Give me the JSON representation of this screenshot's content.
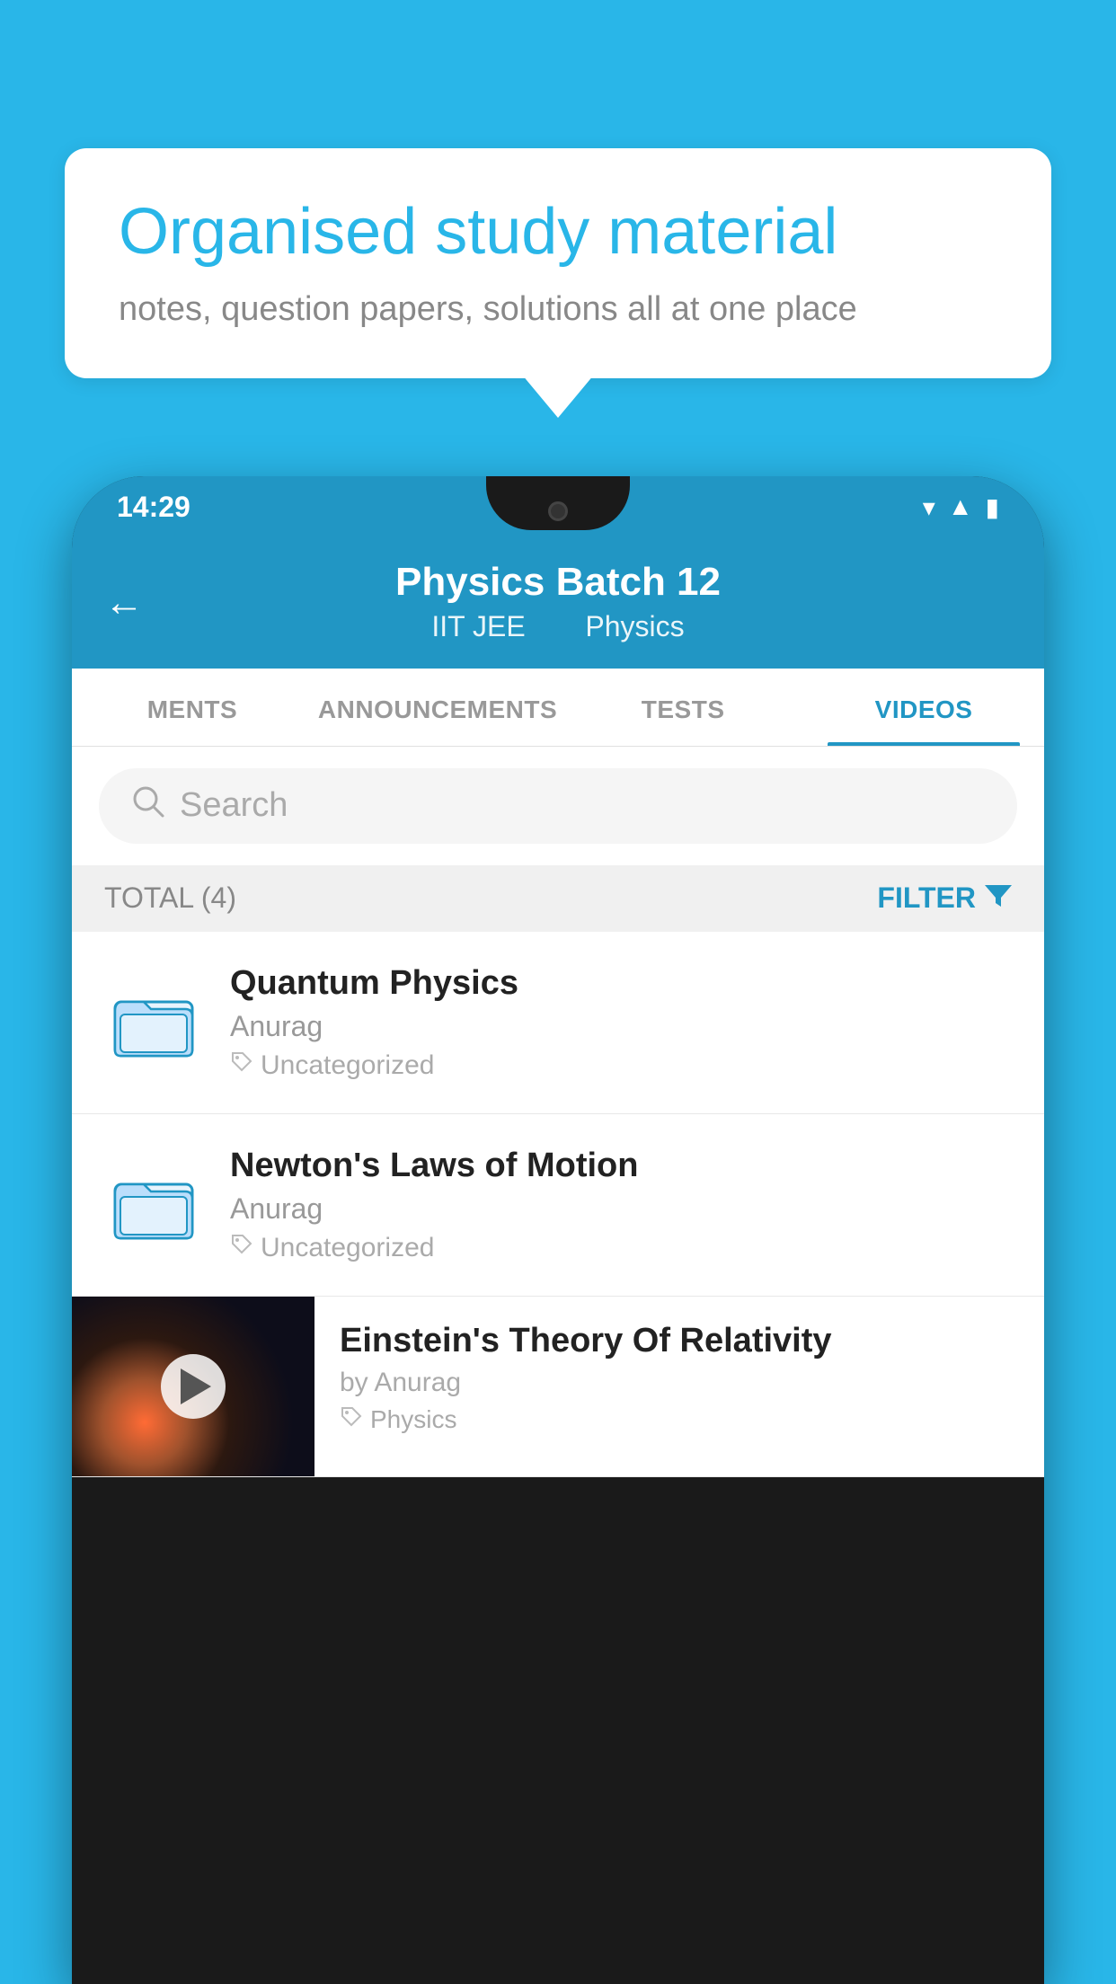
{
  "background": {
    "color": "#29b6e8"
  },
  "bubble": {
    "title": "Organised study material",
    "subtitle": "notes, question papers, solutions all at one place"
  },
  "phone": {
    "statusBar": {
      "time": "14:29"
    },
    "header": {
      "title": "Physics Batch 12",
      "subtitle1": "IIT JEE",
      "subtitle2": "Physics",
      "backLabel": "←"
    },
    "tabs": [
      {
        "label": "MENTS",
        "active": false
      },
      {
        "label": "ANNOUNCEMENTS",
        "active": false
      },
      {
        "label": "TESTS",
        "active": false
      },
      {
        "label": "VIDEOS",
        "active": true
      }
    ],
    "search": {
      "placeholder": "Search"
    },
    "filter": {
      "total": "TOTAL (4)",
      "label": "FILTER"
    },
    "videos": [
      {
        "title": "Quantum Physics",
        "author": "Anurag",
        "tag": "Uncategorized",
        "type": "folder"
      },
      {
        "title": "Newton's Laws of Motion",
        "author": "Anurag",
        "tag": "Uncategorized",
        "type": "folder"
      },
      {
        "title": "Einstein's Theory Of Relativity",
        "author": "by Anurag",
        "tag": "Physics",
        "type": "video"
      }
    ]
  }
}
